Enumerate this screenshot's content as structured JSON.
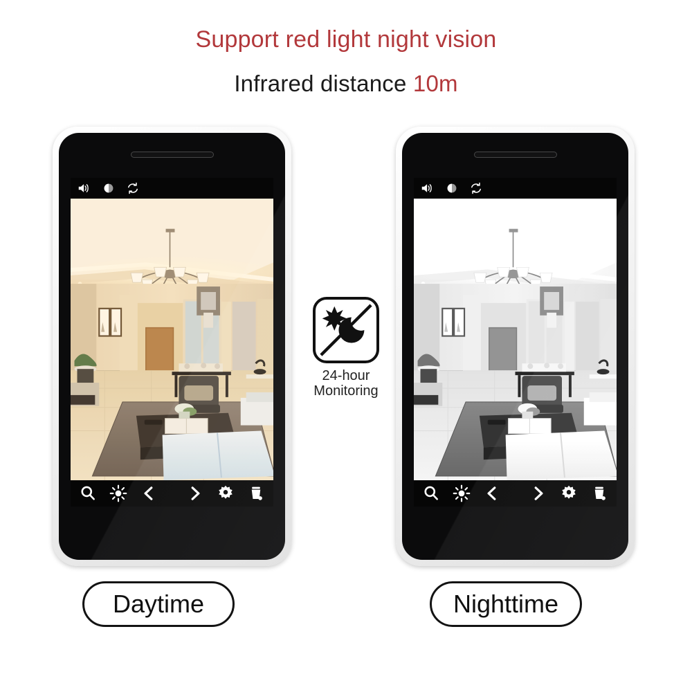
{
  "headings": {
    "line1": "Support red light night vision",
    "line2_prefix": "Infrared distance ",
    "line2_value": "10m"
  },
  "colors": {
    "accent_red": "#b2383b",
    "text_dark": "#1b1b1b",
    "phone_frame": "#ffffff",
    "phone_body": "#0b0b0c",
    "toolbar_bg": "#060606"
  },
  "badge": {
    "caption_line1": "24-hour",
    "caption_line2": "Monitoring",
    "sun_icon": "sun-burst-icon",
    "moon_icon": "crescent-moon-icon",
    "divider": "diagonal-divider"
  },
  "phones": [
    {
      "id": "daytime",
      "label": "Daytime",
      "mode": "color",
      "scene_alt": "living-room-camera-feed-daytime",
      "top_toolbar": [
        {
          "name": "volume-icon",
          "label": "Volume"
        },
        {
          "name": "contrast-icon",
          "label": "Contrast"
        },
        {
          "name": "rotate-refresh-icon",
          "label": "Rotate"
        }
      ],
      "bottom_toolbar_left": [
        {
          "name": "search-icon",
          "label": "Zoom"
        },
        {
          "name": "brightness-icon",
          "label": "Brightness"
        },
        {
          "name": "chevron-left-icon",
          "label": "Previous"
        }
      ],
      "bottom_toolbar_right": [
        {
          "name": "chevron-right-icon",
          "label": "Next"
        },
        {
          "name": "gear-icon",
          "label": "Settings"
        },
        {
          "name": "trash-icon",
          "label": "Delete"
        }
      ]
    },
    {
      "id": "nighttime",
      "label": "Nighttime",
      "mode": "grayscale",
      "scene_alt": "living-room-camera-feed-nighttime-infrared",
      "top_toolbar": [
        {
          "name": "volume-icon",
          "label": "Volume"
        },
        {
          "name": "contrast-icon",
          "label": "Contrast"
        },
        {
          "name": "rotate-refresh-icon",
          "label": "Rotate"
        }
      ],
      "bottom_toolbar_left": [
        {
          "name": "search-icon",
          "label": "Zoom"
        },
        {
          "name": "brightness-icon",
          "label": "Brightness"
        },
        {
          "name": "chevron-left-icon",
          "label": "Previous"
        }
      ],
      "bottom_toolbar_right": [
        {
          "name": "chevron-right-icon",
          "label": "Next"
        },
        {
          "name": "gear-icon",
          "label": "Settings"
        },
        {
          "name": "trash-icon",
          "label": "Delete"
        }
      ]
    }
  ]
}
